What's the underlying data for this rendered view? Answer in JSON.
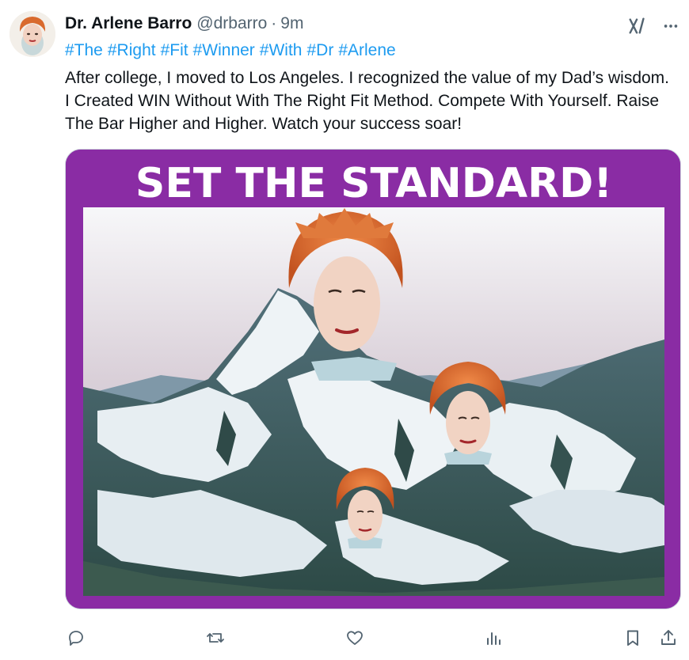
{
  "tweet": {
    "author_name": "Dr. Arlene Barro",
    "author_handle": "@drbarro",
    "separator": "·",
    "timestamp": "9m",
    "hashtags": [
      "#The",
      "#Right",
      "#Fit",
      "#Winner",
      "#With",
      "#Dr",
      "#Arlene"
    ],
    "text": "After college, I moved to Los Angeles. I recognized the value of my Dad’s wisdom. I Created WIN Without With The Right Fit Method. Compete With Yourself. Raise The Bar Higher and Higher. Watch your success soar!",
    "media": {
      "banner_text": "SET THE STANDARD!",
      "frame_color": "#8a2ca4",
      "scene": "snow-capped mountain with three red-haired portraits"
    }
  },
  "icons": {
    "header": [
      "grok-icon",
      "more-icon"
    ],
    "actions": [
      "reply-icon",
      "retweet-icon",
      "like-icon",
      "views-icon",
      "bookmark-icon",
      "share-icon"
    ]
  },
  "colors": {
    "text": "#0f1419",
    "secondary": "#536471",
    "link": "#1d9bf0",
    "hair": "#d96a2e"
  }
}
